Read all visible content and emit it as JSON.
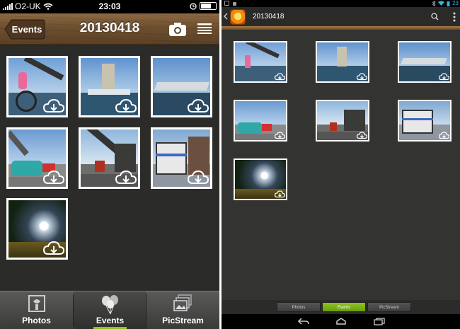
{
  "ios": {
    "status": {
      "carrier": "O2-UK",
      "time": "23:03"
    },
    "nav": {
      "back_label": "Events",
      "title": "20130418"
    },
    "photos": [
      {
        "subject": "cyclist by bridge",
        "action": "download-icon"
      },
      {
        "subject": "tower and boat",
        "action": "download-icon"
      },
      {
        "subject": "building on water",
        "action": "download-icon"
      },
      {
        "subject": "car under arch",
        "action": "download-icon"
      },
      {
        "subject": "station with cyclist",
        "action": "download-icon"
      },
      {
        "subject": "tram",
        "action": "download-icon"
      },
      {
        "subject": "tunnel lights",
        "action": "download-icon"
      }
    ],
    "tabs": [
      {
        "label": "Photos",
        "icon": "photos-icon",
        "active": false
      },
      {
        "label": "Events",
        "icon": "balloons-icon",
        "active": true
      },
      {
        "label": "PicStream",
        "icon": "picstream-icon",
        "active": false
      }
    ]
  },
  "android": {
    "title": "20130418",
    "status": {
      "time": "23"
    },
    "photos": [
      {
        "subject": "cyclist by bridge",
        "action": "download-icon"
      },
      {
        "subject": "tower and boat",
        "action": "download-icon"
      },
      {
        "subject": "building on water",
        "action": "download-icon"
      },
      {
        "subject": "car under arch",
        "action": "download-icon"
      },
      {
        "subject": "station with cyclist",
        "action": "download-icon"
      },
      {
        "subject": "tram",
        "action": "download-icon"
      },
      {
        "subject": "tunnel lights",
        "action": "download-icon"
      }
    ],
    "segments": [
      {
        "label": "Photos",
        "active": false
      },
      {
        "label": "Events",
        "active": true
      },
      {
        "label": "PicStream",
        "active": false
      }
    ]
  },
  "colors": {
    "accent": "#8fc31f",
    "wood": "#6d4f2f",
    "background": "#2b2b29"
  }
}
